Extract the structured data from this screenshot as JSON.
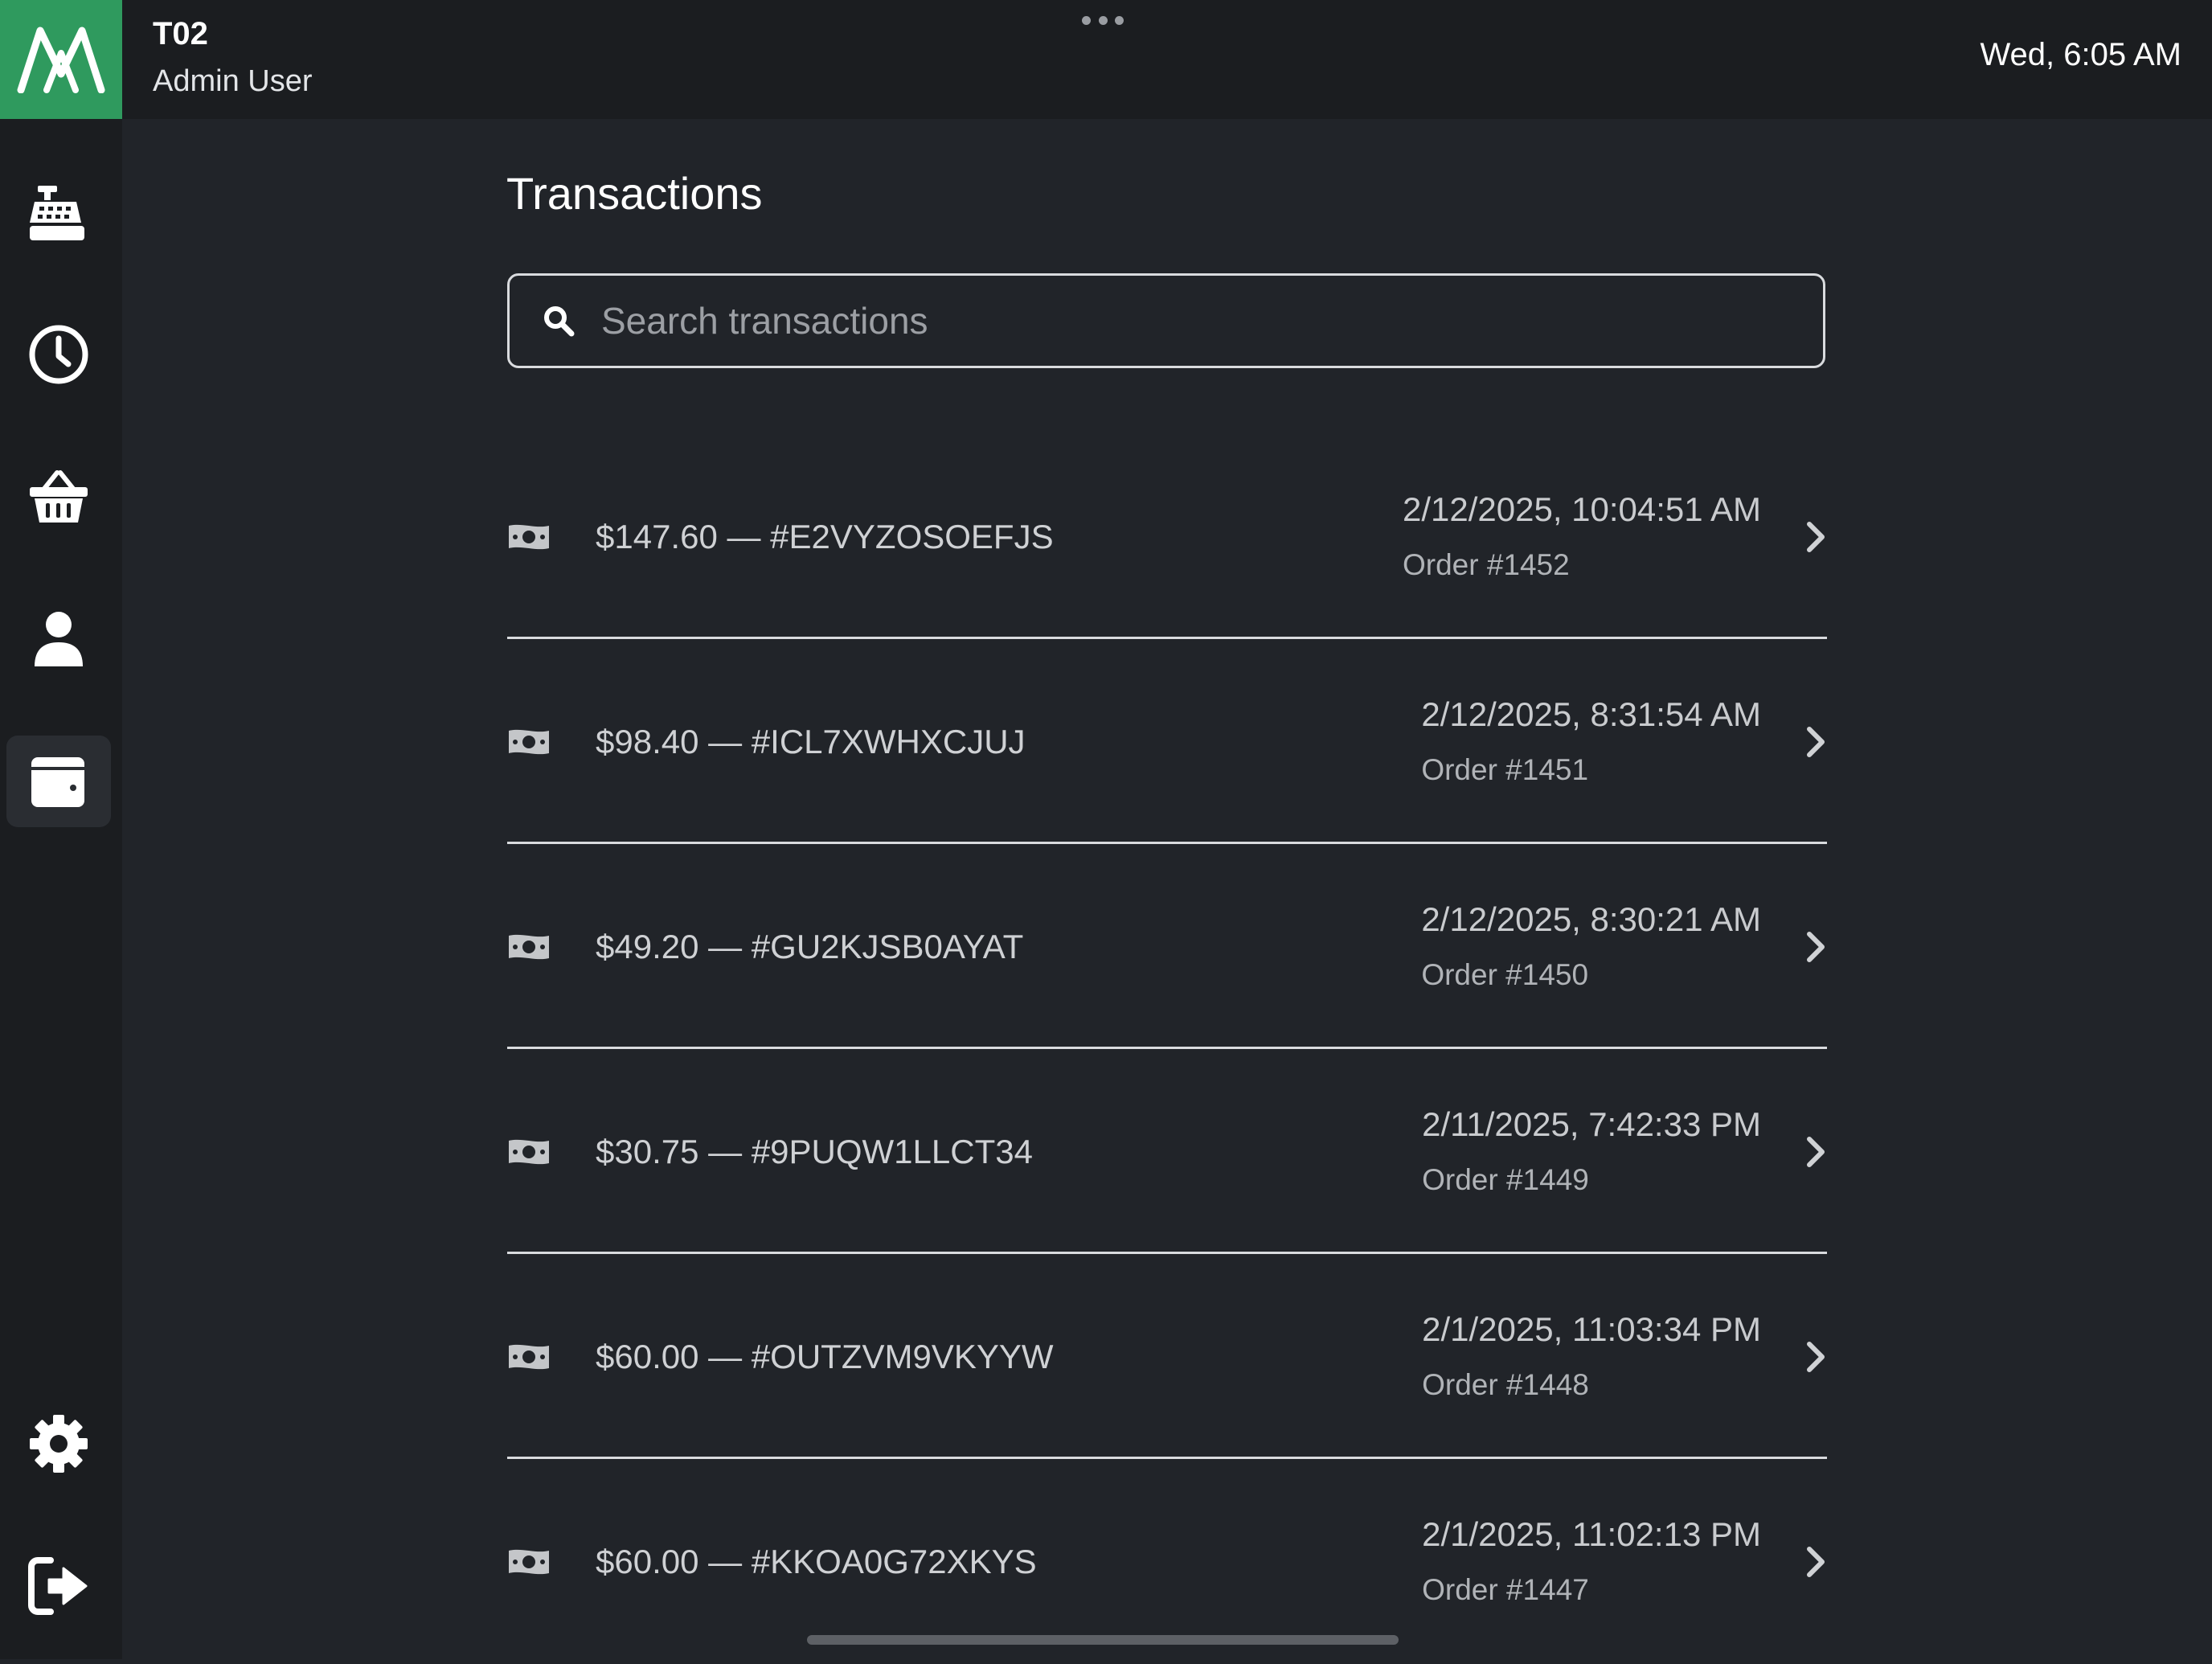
{
  "header": {
    "terminal": "T02",
    "user": "Admin User",
    "clock": "Wed, 6:05 AM"
  },
  "sidebar": {
    "items": [
      {
        "icon": "cash-register-icon",
        "label": "Register"
      },
      {
        "icon": "clock-icon",
        "label": "History"
      },
      {
        "icon": "basket-icon",
        "label": "Orders"
      },
      {
        "icon": "user-icon",
        "label": "Customers"
      },
      {
        "icon": "wallet-icon",
        "label": "Transactions",
        "active": true
      },
      {
        "icon": "gear-icon",
        "label": "Settings"
      },
      {
        "icon": "sign-out-icon",
        "label": "Sign out"
      }
    ]
  },
  "main": {
    "title": "Transactions",
    "search": {
      "placeholder": "Search transactions",
      "value": ""
    },
    "transactions": [
      {
        "amount_ref": "$147.60 — #E2VYZOSOEFJS",
        "datetime": "2/12/2025, 10:04:51 AM",
        "order": "Order #1452"
      },
      {
        "amount_ref": "$98.40 — #ICL7XWHXCJUJ",
        "datetime": "2/12/2025, 8:31:54 AM",
        "order": "Order #1451"
      },
      {
        "amount_ref": "$49.20 — #GU2KJSB0AYAT",
        "datetime": "2/12/2025, 8:30:21 AM",
        "order": "Order #1450"
      },
      {
        "amount_ref": "$30.75 — #9PUQW1LLCT34",
        "datetime": "2/11/2025, 7:42:33 PM",
        "order": "Order #1449"
      },
      {
        "amount_ref": "$60.00 — #OUTZVM9VKYYW",
        "datetime": "2/1/2025, 11:03:34 PM",
        "order": "Order #1448"
      },
      {
        "amount_ref": "$60.00 — #KKOA0G72XKYS",
        "datetime": "2/1/2025, 11:02:13 PM",
        "order": "Order #1447"
      }
    ]
  },
  "colors": {
    "brand": "#2f9a5e",
    "background": "#212429",
    "sidebar": "#1b1d20"
  }
}
